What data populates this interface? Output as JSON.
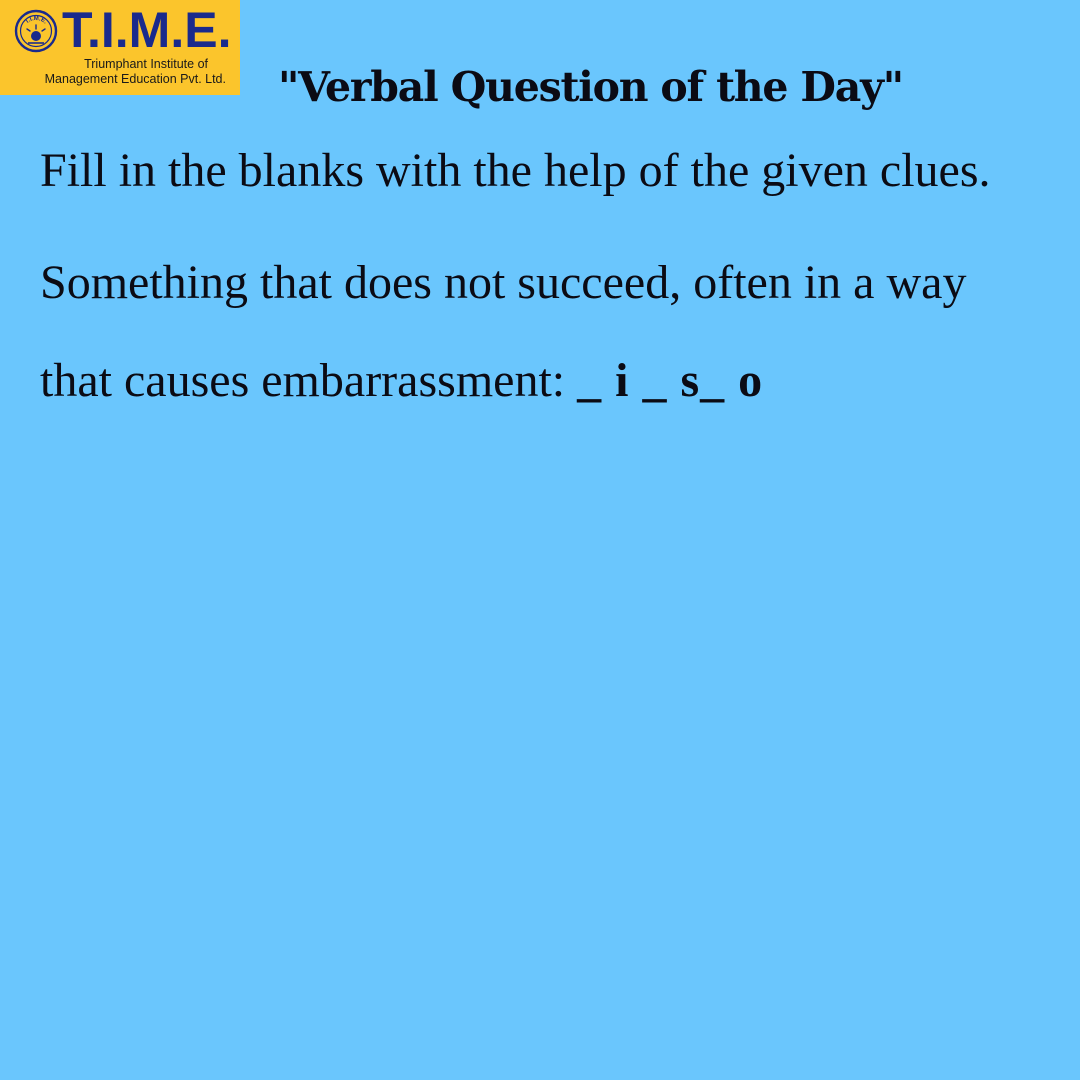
{
  "logo": {
    "emblem_icon": "time-emblem-icon",
    "emblem_text": "T.I.M.E.",
    "wordmark": "T.I.M.E.",
    "tagline_line1": "Triumphant Institute of",
    "tagline_line2": "Management Education Pvt. Ltd.",
    "brand_color": "#1a2a8c",
    "background": "#fbc52c"
  },
  "header": {
    "title": "\"Verbal Question of the Day\""
  },
  "question": {
    "instruction": "Fill in the blanks with the help of the given clues.",
    "clue": "Something that does not succeed, often in a way that causes embarrassment:",
    "pattern": "_ i _ s_ o"
  },
  "colors": {
    "page_background": "#6ac6fd",
    "text": "#0b0b14"
  }
}
